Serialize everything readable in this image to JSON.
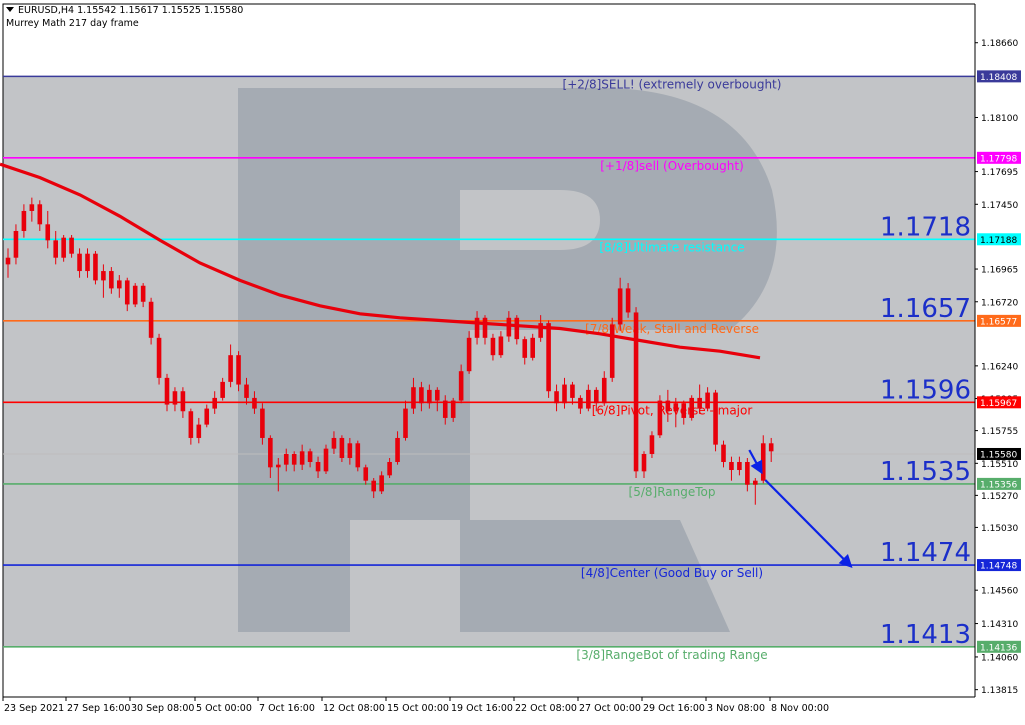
{
  "header": {
    "symbol_line": "EURUSD,H4  1.15542 1.15617 1.15525 1.15580",
    "indicator": "Murrey Math 217 day frame",
    "menu_icon": "triangle-down-icon"
  },
  "colors": {
    "gray_band": "#c2c4c7",
    "watermark": "#8e97a3",
    "candle": "#e8000b",
    "ma": "#e8000b",
    "arrow": "#0b22e6",
    "big_label": "#1b2fc9"
  },
  "chart_data": {
    "type": "candlestick",
    "symbol": "EURUSD",
    "timeframe": "H4",
    "price_range": [
      1.1376,
      1.1895
    ],
    "y_ticks": [
      "1.18660",
      "1.18408",
      "1.18100",
      "1.17798",
      "1.17695",
      "1.17450",
      "1.17188",
      "1.16965",
      "1.16720",
      "1.16577",
      "1.16240",
      "1.15995",
      "1.15967",
      "1.15755",
      "1.15580",
      "1.15510",
      "1.15356",
      "1.15270",
      "1.15030",
      "1.14748",
      "1.14560",
      "1.14310",
      "1.14136",
      "1.14060",
      "1.13815"
    ],
    "x_ticks": [
      "23 Sep 2021",
      "27 Sep 16:00",
      "30 Sep 08:00",
      "5 Oct 00:00",
      "7 Oct 16:00",
      "12 Oct 08:00",
      "15 Oct 00:00",
      "19 Oct 16:00",
      "22 Oct 08:00",
      "27 Oct 00:00",
      "29 Oct 16:00",
      "3 Nov 08:00",
      "8 Nov 00:00"
    ],
    "current_price": "1.15580",
    "levels": [
      {
        "price": 1.18408,
        "tag": "1.18408",
        "label": "[+2/8]SELL! (extremely overbought)",
        "color": "#3a3a9a",
        "big": ""
      },
      {
        "price": 1.17798,
        "tag": "1.17798",
        "label": "[+1/8]sell (Overbought)",
        "color": "#ff00ff",
        "big": ""
      },
      {
        "price": 1.17188,
        "tag": "1.17188",
        "label": "[8/8]Ultimate resistance",
        "color": "#00ffff",
        "big": "1.1718"
      },
      {
        "price": 1.16577,
        "tag": "1.16577",
        "label": "[7/8]Weak, Stall and Reverse",
        "color": "#ff6a1a",
        "big": "1.1657"
      },
      {
        "price": 1.15967,
        "tag": "1.15967",
        "label": "[6/8]Pivot, Reverse - major",
        "color": "#ff0000",
        "big": "1.1596"
      },
      {
        "price": 1.15356,
        "tag": "1.15356",
        "label": "[5/8]RangeTop",
        "color": "#57ad6b",
        "big": "1.1535"
      },
      {
        "price": 1.14748,
        "tag": "1.14748",
        "label": "[4/8]Center (Good Buy or Sell)",
        "color": "#1526d8",
        "big": "1.1474"
      },
      {
        "price": 1.14136,
        "tag": "1.14136",
        "label": "[3/8]RangeBot of trading Range",
        "color": "#57ad6b",
        "big": "1.1413"
      }
    ],
    "shaded_zones": [
      [
        1.15356,
        1.18408
      ],
      [
        1.14136,
        1.15356
      ]
    ],
    "moving_average": [
      [
        0,
        1.1775
      ],
      [
        40,
        1.1765
      ],
      [
        80,
        1.1752
      ],
      [
        120,
        1.1736
      ],
      [
        160,
        1.1718
      ],
      [
        200,
        1.1701
      ],
      [
        240,
        1.1688
      ],
      [
        280,
        1.1677
      ],
      [
        320,
        1.1669
      ],
      [
        360,
        1.1663
      ],
      [
        400,
        1.166
      ],
      [
        440,
        1.1658
      ],
      [
        480,
        1.1656
      ],
      [
        520,
        1.1654
      ],
      [
        560,
        1.1652
      ],
      [
        600,
        1.1648
      ],
      [
        640,
        1.1643
      ],
      [
        680,
        1.1638
      ],
      [
        720,
        1.1635
      ],
      [
        760,
        1.163
      ]
    ],
    "candles": [
      [
        1.17,
        1.1712,
        1.169,
        1.1705
      ],
      [
        1.1705,
        1.173,
        1.17,
        1.1725
      ],
      [
        1.1725,
        1.1745,
        1.172,
        1.174
      ],
      [
        1.174,
        1.175,
        1.1732,
        1.1745
      ],
      [
        1.1745,
        1.1748,
        1.1725,
        1.173
      ],
      [
        1.173,
        1.174,
        1.1712,
        1.1718
      ],
      [
        1.1718,
        1.1725,
        1.17,
        1.1705
      ],
      [
        1.1705,
        1.1722,
        1.1702,
        1.172
      ],
      [
        1.172,
        1.1722,
        1.1705,
        1.1708
      ],
      [
        1.1708,
        1.1712,
        1.169,
        1.1695
      ],
      [
        1.1695,
        1.1712,
        1.169,
        1.1708
      ],
      [
        1.1708,
        1.171,
        1.1685,
        1.1688
      ],
      [
        1.1688,
        1.17,
        1.1675,
        1.1695
      ],
      [
        1.1695,
        1.1698,
        1.1678,
        1.1682
      ],
      [
        1.1682,
        1.1692,
        1.1675,
        1.1688
      ],
      [
        1.1688,
        1.169,
        1.1665,
        1.167
      ],
      [
        1.167,
        1.1686,
        1.1668,
        1.1684
      ],
      [
        1.1684,
        1.1686,
        1.1668,
        1.1672
      ],
      [
        1.1672,
        1.1675,
        1.164,
        1.1645
      ],
      [
        1.1645,
        1.1648,
        1.161,
        1.1615
      ],
      [
        1.1615,
        1.1618,
        1.159,
        1.1595
      ],
      [
        1.1595,
        1.1608,
        1.159,
        1.1605
      ],
      [
        1.1605,
        1.1608,
        1.1585,
        1.159
      ],
      [
        1.159,
        1.1592,
        1.1565,
        1.157
      ],
      [
        1.157,
        1.1585,
        1.1566,
        1.158
      ],
      [
        1.158,
        1.1595,
        1.1578,
        1.1592
      ],
      [
        1.1592,
        1.1605,
        1.1588,
        1.16
      ],
      [
        1.16,
        1.1615,
        1.1598,
        1.1612
      ],
      [
        1.1612,
        1.164,
        1.1608,
        1.1632
      ],
      [
        1.1632,
        1.1635,
        1.1605,
        1.161
      ],
      [
        1.161,
        1.1615,
        1.1595,
        1.16
      ],
      [
        1.16,
        1.1605,
        1.1588,
        1.1592
      ],
      [
        1.1592,
        1.1596,
        1.1565,
        1.157
      ],
      [
        1.157,
        1.1572,
        1.154,
        1.1548
      ],
      [
        1.1548,
        1.1555,
        1.153,
        1.155
      ],
      [
        1.155,
        1.1562,
        1.1545,
        1.1558
      ],
      [
        1.1558,
        1.156,
        1.1545,
        1.155
      ],
      [
        1.155,
        1.1565,
        1.1546,
        1.156
      ],
      [
        1.156,
        1.1562,
        1.1548,
        1.1552
      ],
      [
        1.1552,
        1.1556,
        1.154,
        1.1545
      ],
      [
        1.1545,
        1.1565,
        1.1543,
        1.1562
      ],
      [
        1.1562,
        1.1575,
        1.1558,
        1.157
      ],
      [
        1.157,
        1.1572,
        1.1552,
        1.1555
      ],
      [
        1.1555,
        1.157,
        1.155,
        1.1566
      ],
      [
        1.1566,
        1.1568,
        1.1545,
        1.1548
      ],
      [
        1.1548,
        1.155,
        1.1535,
        1.1538
      ],
      [
        1.1538,
        1.154,
        1.1525,
        1.153
      ],
      [
        1.153,
        1.1545,
        1.1528,
        1.1542
      ],
      [
        1.1542,
        1.1555,
        1.154,
        1.1552
      ],
      [
        1.1552,
        1.1575,
        1.155,
        1.157
      ],
      [
        1.157,
        1.1598,
        1.1568,
        1.1592
      ],
      [
        1.1592,
        1.1615,
        1.1588,
        1.1608
      ],
      [
        1.1608,
        1.1612,
        1.159,
        1.1596
      ],
      [
        1.1596,
        1.161,
        1.1592,
        1.1606
      ],
      [
        1.1606,
        1.1608,
        1.159,
        1.1598
      ],
      [
        1.1598,
        1.1602,
        1.158,
        1.1585
      ],
      [
        1.1585,
        1.16,
        1.1582,
        1.1598
      ],
      [
        1.1598,
        1.1625,
        1.1596,
        1.162
      ],
      [
        1.162,
        1.165,
        1.1618,
        1.1645
      ],
      [
        1.1645,
        1.1665,
        1.164,
        1.166
      ],
      [
        1.166,
        1.1662,
        1.164,
        1.1645
      ],
      [
        1.1645,
        1.1648,
        1.1628,
        1.1632
      ],
      [
        1.1632,
        1.165,
        1.163,
        1.1646
      ],
      [
        1.1646,
        1.1665,
        1.1642,
        1.166
      ],
      [
        1.166,
        1.1662,
        1.164,
        1.1644
      ],
      [
        1.1644,
        1.1646,
        1.1625,
        1.163
      ],
      [
        1.163,
        1.1648,
        1.1628,
        1.1645
      ],
      [
        1.1645,
        1.1662,
        1.1642,
        1.1656
      ],
      [
        1.1656,
        1.1658,
        1.16,
        1.1605
      ],
      [
        1.1605,
        1.161,
        1.159,
        1.1596
      ],
      [
        1.1596,
        1.1615,
        1.1592,
        1.161
      ],
      [
        1.161,
        1.1612,
        1.1595,
        1.16
      ],
      [
        1.16,
        1.1602,
        1.1588,
        1.1592
      ],
      [
        1.1592,
        1.161,
        1.159,
        1.1606
      ],
      [
        1.1606,
        1.1608,
        1.159,
        1.1596
      ],
      [
        1.1596,
        1.162,
        1.1594,
        1.1615
      ],
      [
        1.1615,
        1.166,
        1.1612,
        1.1655
      ],
      [
        1.1655,
        1.169,
        1.165,
        1.1682
      ],
      [
        1.1682,
        1.1686,
        1.166,
        1.1664
      ],
      [
        1.1664,
        1.1668,
        1.154,
        1.1545
      ],
      [
        1.1545,
        1.156,
        1.154,
        1.1558
      ],
      [
        1.1558,
        1.1575,
        1.1555,
        1.1572
      ],
      [
        1.1572,
        1.1602,
        1.157,
        1.1598
      ],
      [
        1.1598,
        1.1606,
        1.1582,
        1.159
      ],
      [
        1.159,
        1.16,
        1.1578,
        1.1596
      ],
      [
        1.1596,
        1.1598,
        1.158,
        1.1585
      ],
      [
        1.1585,
        1.1602,
        1.1583,
        1.16
      ],
      [
        1.16,
        1.161,
        1.1588,
        1.1592
      ],
      [
        1.1592,
        1.1608,
        1.159,
        1.1604
      ],
      [
        1.1604,
        1.1606,
        1.156,
        1.1565
      ],
      [
        1.1565,
        1.1568,
        1.1548,
        1.1552
      ],
      [
        1.1552,
        1.1556,
        1.1538,
        1.1546
      ],
      [
        1.1546,
        1.1556,
        1.1542,
        1.1552
      ],
      [
        1.1552,
        1.1555,
        1.153,
        1.1535
      ],
      [
        1.1535,
        1.154,
        1.152,
        1.1538
      ],
      [
        1.1538,
        1.1572,
        1.1536,
        1.1566
      ],
      [
        1.1566,
        1.157,
        1.1552,
        1.156
      ]
    ],
    "forecast_arrow": {
      "from": [
        94,
        1.1555
      ],
      "to": [
        106,
        1.1474
      ]
    }
  }
}
